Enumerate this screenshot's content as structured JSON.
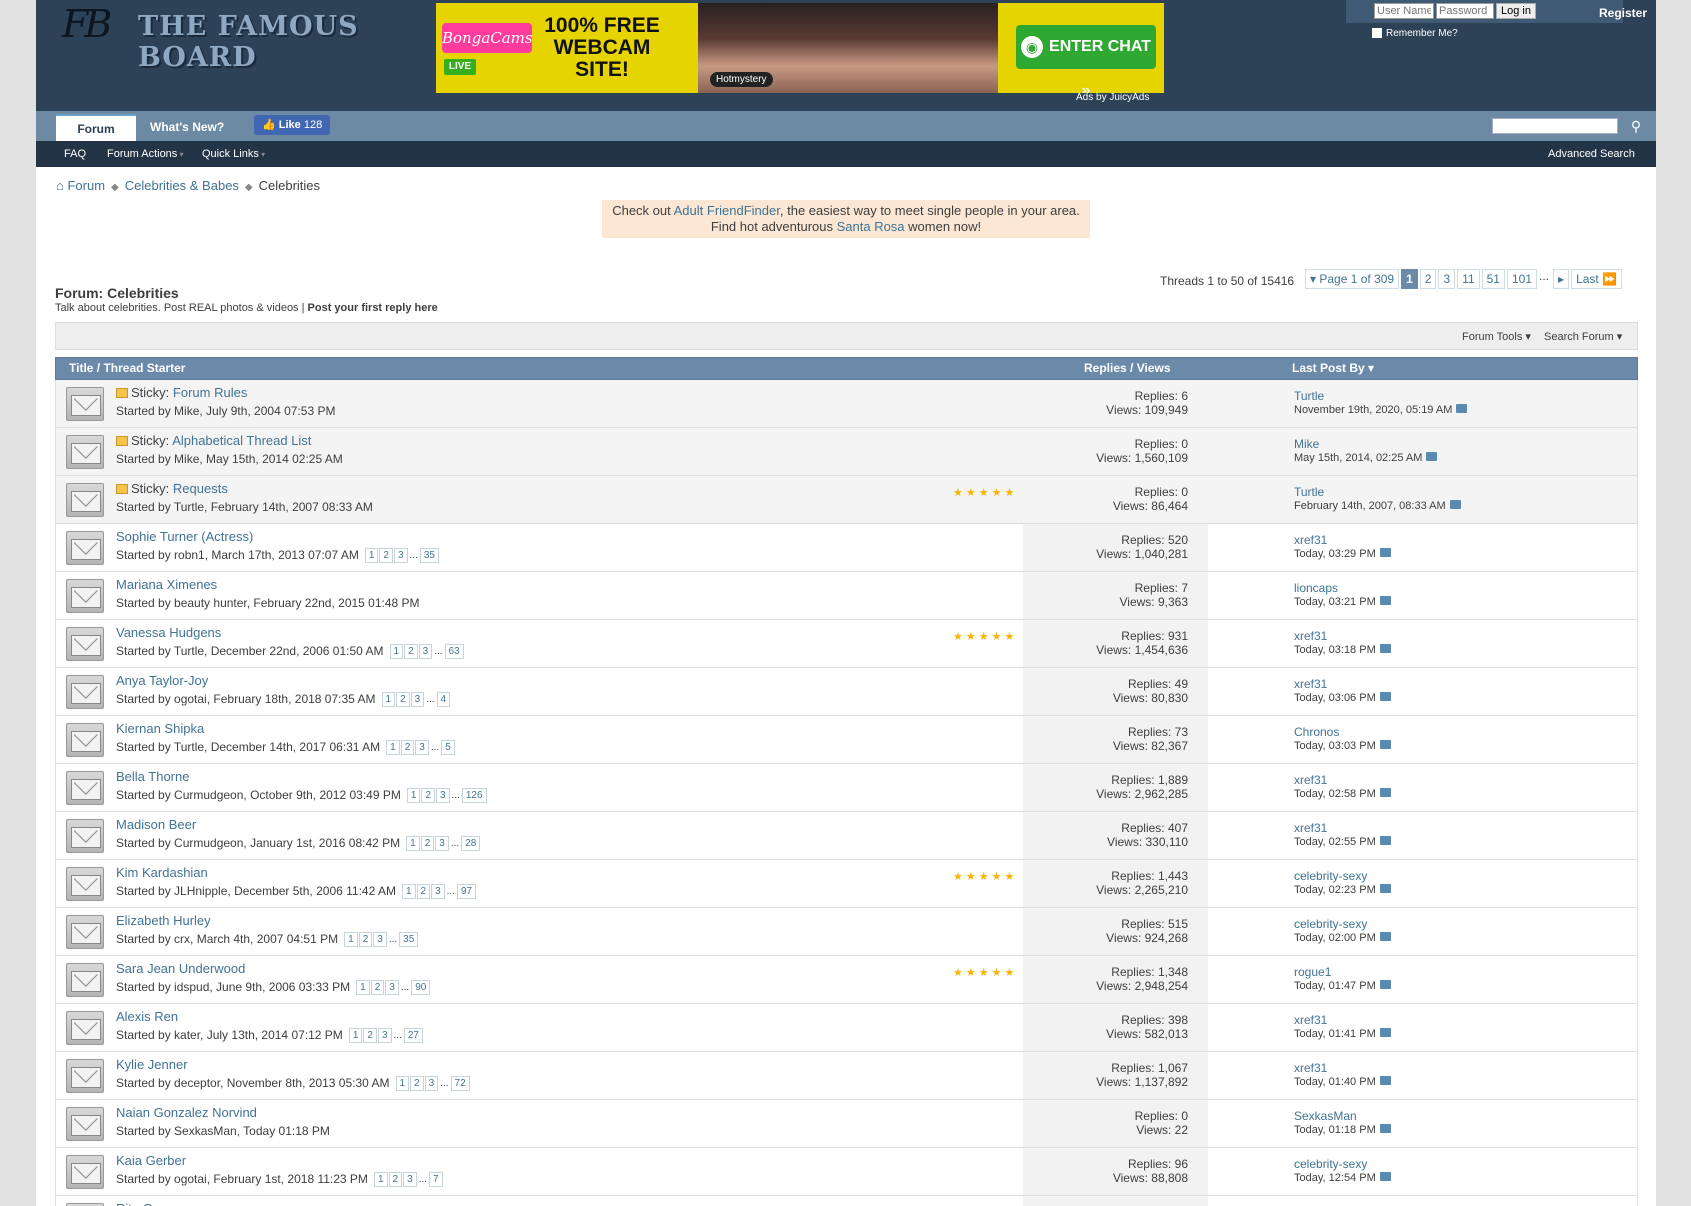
{
  "header": {
    "logo_mark": "FB",
    "logo_name": "THE FAMOUS BOARD",
    "ad": {
      "brand": "BongaCams",
      "live": "LIVE",
      "headline": "100% FREE WEBCAM SITE!",
      "model": "Hotmystery",
      "cta": "ENTER CHAT »",
      "ads_by": "Ads by JuicyAds"
    },
    "login": {
      "user_placeholder": "User Name",
      "pass_placeholder": "Password",
      "button": "Log in",
      "remember": "Remember Me?",
      "register": "Register"
    }
  },
  "nav": {
    "tabs": [
      "Forum",
      "What's New?"
    ],
    "like_label": "Like",
    "like_count": "128",
    "sub": [
      "FAQ",
      "Forum Actions",
      "Quick Links"
    ],
    "advanced_search": "Advanced Search"
  },
  "breadcrumb": [
    "Forum",
    "Celebrities & Babes",
    "Celebrities"
  ],
  "promo": {
    "pre": "Check out ",
    "link1": "Adult FriendFinder",
    "mid": ", the easiest way to meet single people in your area.",
    "line2_pre": "Find hot adventurous ",
    "link2": "Santa Rosa",
    "line2_post": " women now!"
  },
  "forum": {
    "title": "Forum: Celebrities",
    "desc": "Talk about celebrities. Post REAL photos & videos | ",
    "desc_bold": "Post your first reply here",
    "thread_count": "Threads 1 to 50 of 15416"
  },
  "pager": {
    "label": "Page 1 of 309",
    "pages": [
      "1",
      "2",
      "3",
      "11",
      "51",
      "101"
    ],
    "last": "Last"
  },
  "tools": [
    "Forum Tools",
    "Search Forum"
  ],
  "columns": [
    "Title / Thread Starter",
    "Replies / Views",
    "Last Post By"
  ],
  "threads": [
    {
      "sticky": true,
      "title": "Forum Rules",
      "starter": "Started by Mike, July 9th, 2004 07:53 PM",
      "pages": [],
      "rated": false,
      "replies": "Replies: 6",
      "views": "Views: 109,949",
      "last_by": "Turtle",
      "last_when": "November 19th, 2020, 05:19 AM"
    },
    {
      "sticky": true,
      "title": "Alphabetical Thread List",
      "starter": "Started by Mike, May 15th, 2014 02:25 AM",
      "pages": [],
      "rated": false,
      "replies": "Replies: 0",
      "views": "Views: 1,560,109",
      "last_by": "Mike",
      "last_when": "May 15th, 2014, 02:25 AM"
    },
    {
      "sticky": true,
      "title": "Requests",
      "starter": "Started by Turtle, February 14th, 2007 08:33 AM",
      "pages": [],
      "rated": true,
      "replies": "Replies: 0",
      "views": "Views: 86,464",
      "last_by": "Turtle",
      "last_when": "February 14th, 2007, 08:33 AM"
    },
    {
      "sticky": false,
      "title": "Sophie Turner (Actress)",
      "starter": "Started by robn1, March 17th, 2013 07:07 AM",
      "pages": [
        "1",
        "2",
        "3",
        "35"
      ],
      "rated": false,
      "replies": "Replies: 520",
      "views": "Views: 1,040,281",
      "last_by": "xref31",
      "last_when": "Today, 03:29 PM"
    },
    {
      "sticky": false,
      "title": "Mariana Ximenes",
      "starter": "Started by beauty hunter, February 22nd, 2015 01:48 PM",
      "pages": [],
      "rated": false,
      "replies": "Replies: 7",
      "views": "Views: 9,363",
      "last_by": "lioncaps",
      "last_when": "Today, 03:21 PM"
    },
    {
      "sticky": false,
      "title": "Vanessa Hudgens",
      "starter": "Started by Turtle, December 22nd, 2006 01:50 AM",
      "pages": [
        "1",
        "2",
        "3",
        "63"
      ],
      "rated": true,
      "replies": "Replies: 931",
      "views": "Views: 1,454,636",
      "last_by": "xref31",
      "last_when": "Today, 03:18 PM"
    },
    {
      "sticky": false,
      "title": "Anya Taylor-Joy",
      "starter": "Started by ogotai, February 18th, 2018 07:35 AM",
      "pages": [
        "1",
        "2",
        "3",
        "4"
      ],
      "rated": false,
      "replies": "Replies: 49",
      "views": "Views: 80,830",
      "last_by": "xref31",
      "last_when": "Today, 03:06 PM"
    },
    {
      "sticky": false,
      "title": "Kiernan Shipka",
      "starter": "Started by Turtle, December 14th, 2017 06:31 AM",
      "pages": [
        "1",
        "2",
        "3",
        "5"
      ],
      "rated": false,
      "replies": "Replies: 73",
      "views": "Views: 82,367",
      "last_by": "Chronos",
      "last_when": "Today, 03:03 PM"
    },
    {
      "sticky": false,
      "title": "Bella Thorne",
      "starter": "Started by Curmudgeon, October 9th, 2012 03:49 PM",
      "pages": [
        "1",
        "2",
        "3",
        "126"
      ],
      "rated": false,
      "replies": "Replies: 1,889",
      "views": "Views: 2,962,285",
      "last_by": "xref31",
      "last_when": "Today, 02:58 PM"
    },
    {
      "sticky": false,
      "title": "Madison Beer",
      "starter": "Started by Curmudgeon, January 1st, 2016 08:42 PM",
      "pages": [
        "1",
        "2",
        "3",
        "28"
      ],
      "rated": false,
      "replies": "Replies: 407",
      "views": "Views: 330,110",
      "last_by": "xref31",
      "last_when": "Today, 02:55 PM"
    },
    {
      "sticky": false,
      "title": "Kim Kardashian",
      "starter": "Started by JLHnipple, December 5th, 2006 11:42 AM",
      "pages": [
        "1",
        "2",
        "3",
        "97"
      ],
      "rated": true,
      "replies": "Replies: 1,443",
      "views": "Views: 2,265,210",
      "last_by": "celebrity-sexy",
      "last_when": "Today, 02:23 PM"
    },
    {
      "sticky": false,
      "title": "Elizabeth Hurley",
      "starter": "Started by crx, March 4th, 2007 04:51 PM",
      "pages": [
        "1",
        "2",
        "3",
        "35"
      ],
      "rated": false,
      "replies": "Replies: 515",
      "views": "Views: 924,268",
      "last_by": "celebrity-sexy",
      "last_when": "Today, 02:00 PM"
    },
    {
      "sticky": false,
      "title": "Sara Jean Underwood",
      "starter": "Started by idspud, June 9th, 2006 03:33 PM",
      "pages": [
        "1",
        "2",
        "3",
        "90"
      ],
      "rated": true,
      "replies": "Replies: 1,348",
      "views": "Views: 2,948,254",
      "last_by": "rogue1",
      "last_when": "Today, 01:47 PM"
    },
    {
      "sticky": false,
      "title": "Alexis Ren",
      "starter": "Started by kater, July 13th, 2014 07:12 PM",
      "pages": [
        "1",
        "2",
        "3",
        "27"
      ],
      "rated": false,
      "replies": "Replies: 398",
      "views": "Views: 582,013",
      "last_by": "xref31",
      "last_when": "Today, 01:41 PM"
    },
    {
      "sticky": false,
      "title": "Kylie Jenner",
      "starter": "Started by deceptor, November 8th, 2013 05:30 AM",
      "pages": [
        "1",
        "2",
        "3",
        "72"
      ],
      "rated": false,
      "replies": "Replies: 1,067",
      "views": "Views: 1,137,892",
      "last_by": "xref31",
      "last_when": "Today, 01:40 PM"
    },
    {
      "sticky": false,
      "title": "Naian Gonzalez Norvind",
      "starter": "Started by SexkasMan, Today 01:18 PM",
      "pages": [],
      "rated": false,
      "replies": "Replies: 0",
      "views": "Views: 22",
      "last_by": "SexkasMan",
      "last_when": "Today, 01:18 PM"
    },
    {
      "sticky": false,
      "title": "Kaia Gerber",
      "starter": "Started by ogotai, February 1st, 2018 11:23 PM",
      "pages": [
        "1",
        "2",
        "3",
        "7"
      ],
      "rated": false,
      "replies": "Replies: 96",
      "views": "Views: 88,808",
      "last_by": "celebrity-sexy",
      "last_when": "Today, 12:54 PM"
    },
    {
      "sticky": false,
      "title": "Rita Ora",
      "starter": "",
      "pages": [],
      "rated": false,
      "replies": "",
      "views": "",
      "last_by": "",
      "last_when": ""
    }
  ],
  "icons": {
    "home": "home-icon",
    "search": "search-icon",
    "thread": "envelope-icon",
    "star": "star-icon",
    "go_last": "go-to-last-post-icon"
  }
}
